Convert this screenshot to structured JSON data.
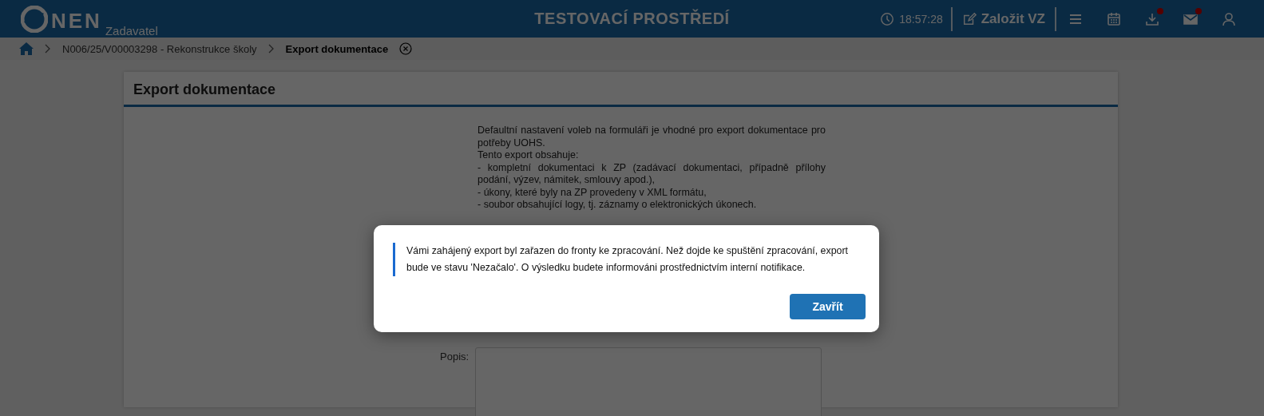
{
  "header": {
    "logo_text": "NEN",
    "subtitle": "Zadavatel",
    "title": "TESTOVACÍ PROSTŘEDÍ",
    "time": "18:57:28",
    "create_label": "Založit VZ",
    "icons": [
      {
        "kind": "menu",
        "badge": false
      },
      {
        "kind": "calendar",
        "badge": false
      },
      {
        "kind": "download",
        "badge": true
      },
      {
        "kind": "mail",
        "badge": true
      },
      {
        "kind": "user",
        "badge": false
      }
    ]
  },
  "breadcrumb": {
    "items": [
      "N006/25/V00003298 - Rekonstrukce školy",
      "Export dokumentace"
    ]
  },
  "card": {
    "title": "Export dokumentace",
    "description": [
      "Defaultní nastavení voleb na formuláři je vhodné pro export dokumentace pro potřeby UOHS.",
      "Tento export obsahuje:",
      "- kompletní dokumentaci k ZP (zadávací dokumentaci, případně přílohy podání, výzev, námitek, smlouvy apod.),",
      "- úkony, které byly na ZP provedeny v XML formátu,",
      "- soubor obsahující logy, tj. záznamy o elektronických úkonech."
    ],
    "field_label": "Popis:"
  },
  "modal": {
    "message": "Vámi zahájený export byl zařazen do fronty ke zpracování. Než dojde ke spuštění zpracování, export bude ve stavu 'Nezačalo'. O výsledku budete informováni prostřednictvím interní notifikace.",
    "button": "Zavřít"
  }
}
